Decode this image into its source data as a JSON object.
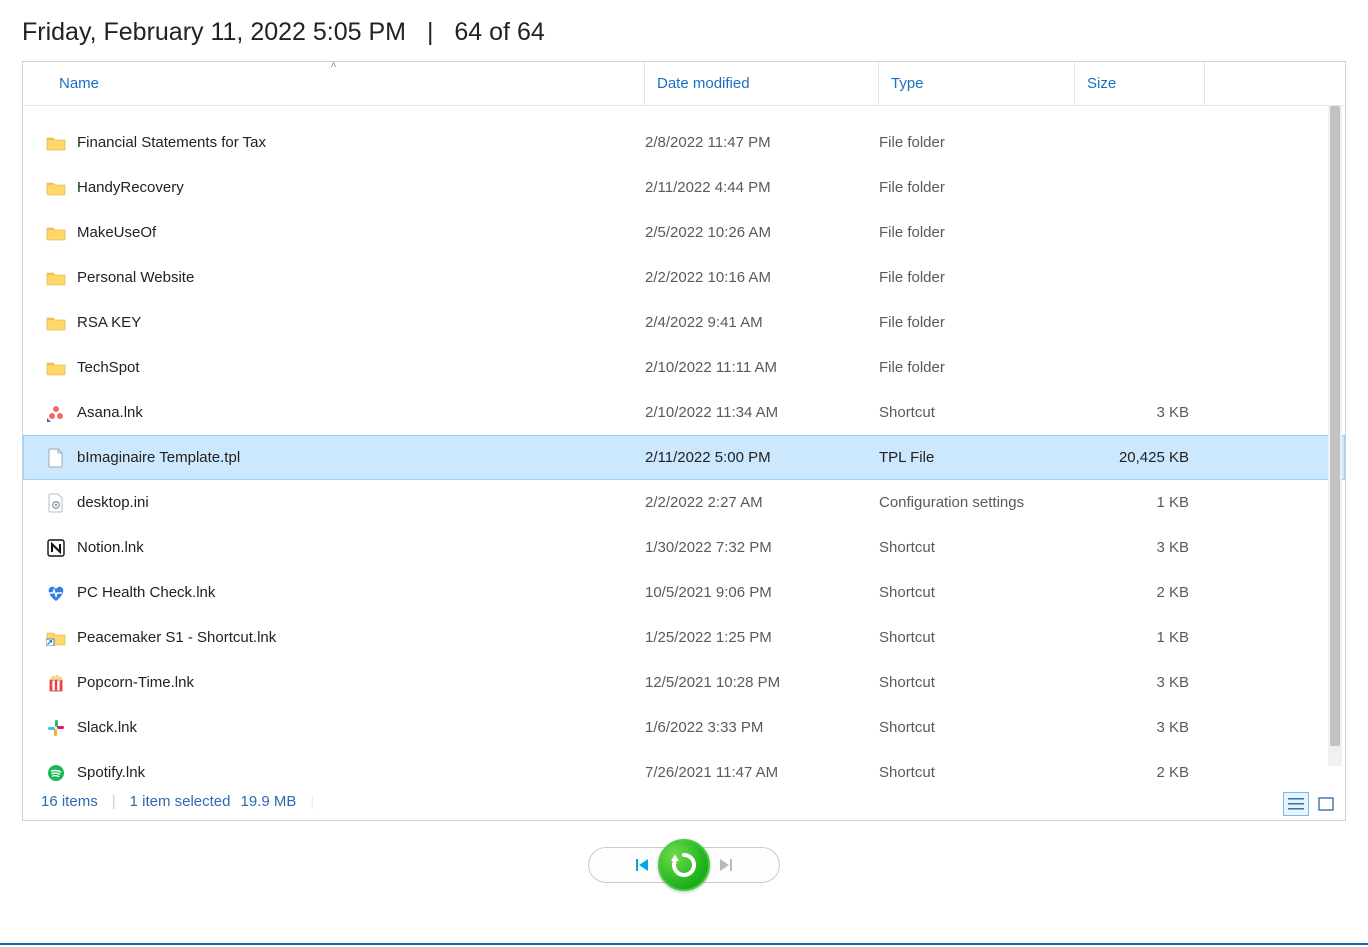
{
  "header": {
    "datetime": "Friday, February 11, 2022 5:05 PM",
    "counter": "64 of 64"
  },
  "columns": {
    "name": "Name",
    "date": "Date modified",
    "type": "Type",
    "size": "Size"
  },
  "files": [
    {
      "icon": "folder",
      "name": "Financial Statements for Tax",
      "date": "2/8/2022 11:47 PM",
      "type": "File folder",
      "size": "",
      "selected": false
    },
    {
      "icon": "folder",
      "name": "HandyRecovery",
      "date": "2/11/2022 4:44 PM",
      "type": "File folder",
      "size": "",
      "selected": false
    },
    {
      "icon": "folder",
      "name": "MakeUseOf",
      "date": "2/5/2022 10:26 AM",
      "type": "File folder",
      "size": "",
      "selected": false
    },
    {
      "icon": "folder",
      "name": "Personal Website",
      "date": "2/2/2022 10:16 AM",
      "type": "File folder",
      "size": "",
      "selected": false
    },
    {
      "icon": "folder",
      "name": "RSA KEY",
      "date": "2/4/2022 9:41 AM",
      "type": "File folder",
      "size": "",
      "selected": false
    },
    {
      "icon": "folder",
      "name": "TechSpot",
      "date": "2/10/2022 11:11 AM",
      "type": "File folder",
      "size": "",
      "selected": false
    },
    {
      "icon": "asana",
      "name": "Asana.lnk",
      "date": "2/10/2022 11:34 AM",
      "type": "Shortcut",
      "size": "3 KB",
      "selected": false
    },
    {
      "icon": "file",
      "name": "bImaginaire Template.tpl",
      "date": "2/11/2022 5:00 PM",
      "type": "TPL File",
      "size": "20,425 KB",
      "selected": true
    },
    {
      "icon": "config",
      "name": "desktop.ini",
      "date": "2/2/2022 2:27 AM",
      "type": "Configuration settings",
      "size": "1 KB",
      "selected": false
    },
    {
      "icon": "notion",
      "name": "Notion.lnk",
      "date": "1/30/2022 7:32 PM",
      "type": "Shortcut",
      "size": "3 KB",
      "selected": false
    },
    {
      "icon": "pchealth",
      "name": "PC Health Check.lnk",
      "date": "10/5/2021 9:06 PM",
      "type": "Shortcut",
      "size": "2 KB",
      "selected": false
    },
    {
      "icon": "foldershortcut",
      "name": "Peacemaker S1 - Shortcut.lnk",
      "date": "1/25/2022 1:25 PM",
      "type": "Shortcut",
      "size": "1 KB",
      "selected": false
    },
    {
      "icon": "popcorn",
      "name": "Popcorn-Time.lnk",
      "date": "12/5/2021 10:28 PM",
      "type": "Shortcut",
      "size": "3 KB",
      "selected": false
    },
    {
      "icon": "slack",
      "name": "Slack.lnk",
      "date": "1/6/2022 3:33 PM",
      "type": "Shortcut",
      "size": "3 KB",
      "selected": false
    },
    {
      "icon": "spotify",
      "name": "Spotify.lnk",
      "date": "7/26/2021 11:47 AM",
      "type": "Shortcut",
      "size": "2 KB",
      "selected": false
    }
  ],
  "status": {
    "item_count": "16 items",
    "selection": "1 item selected",
    "sel_size": "19.9 MB"
  }
}
